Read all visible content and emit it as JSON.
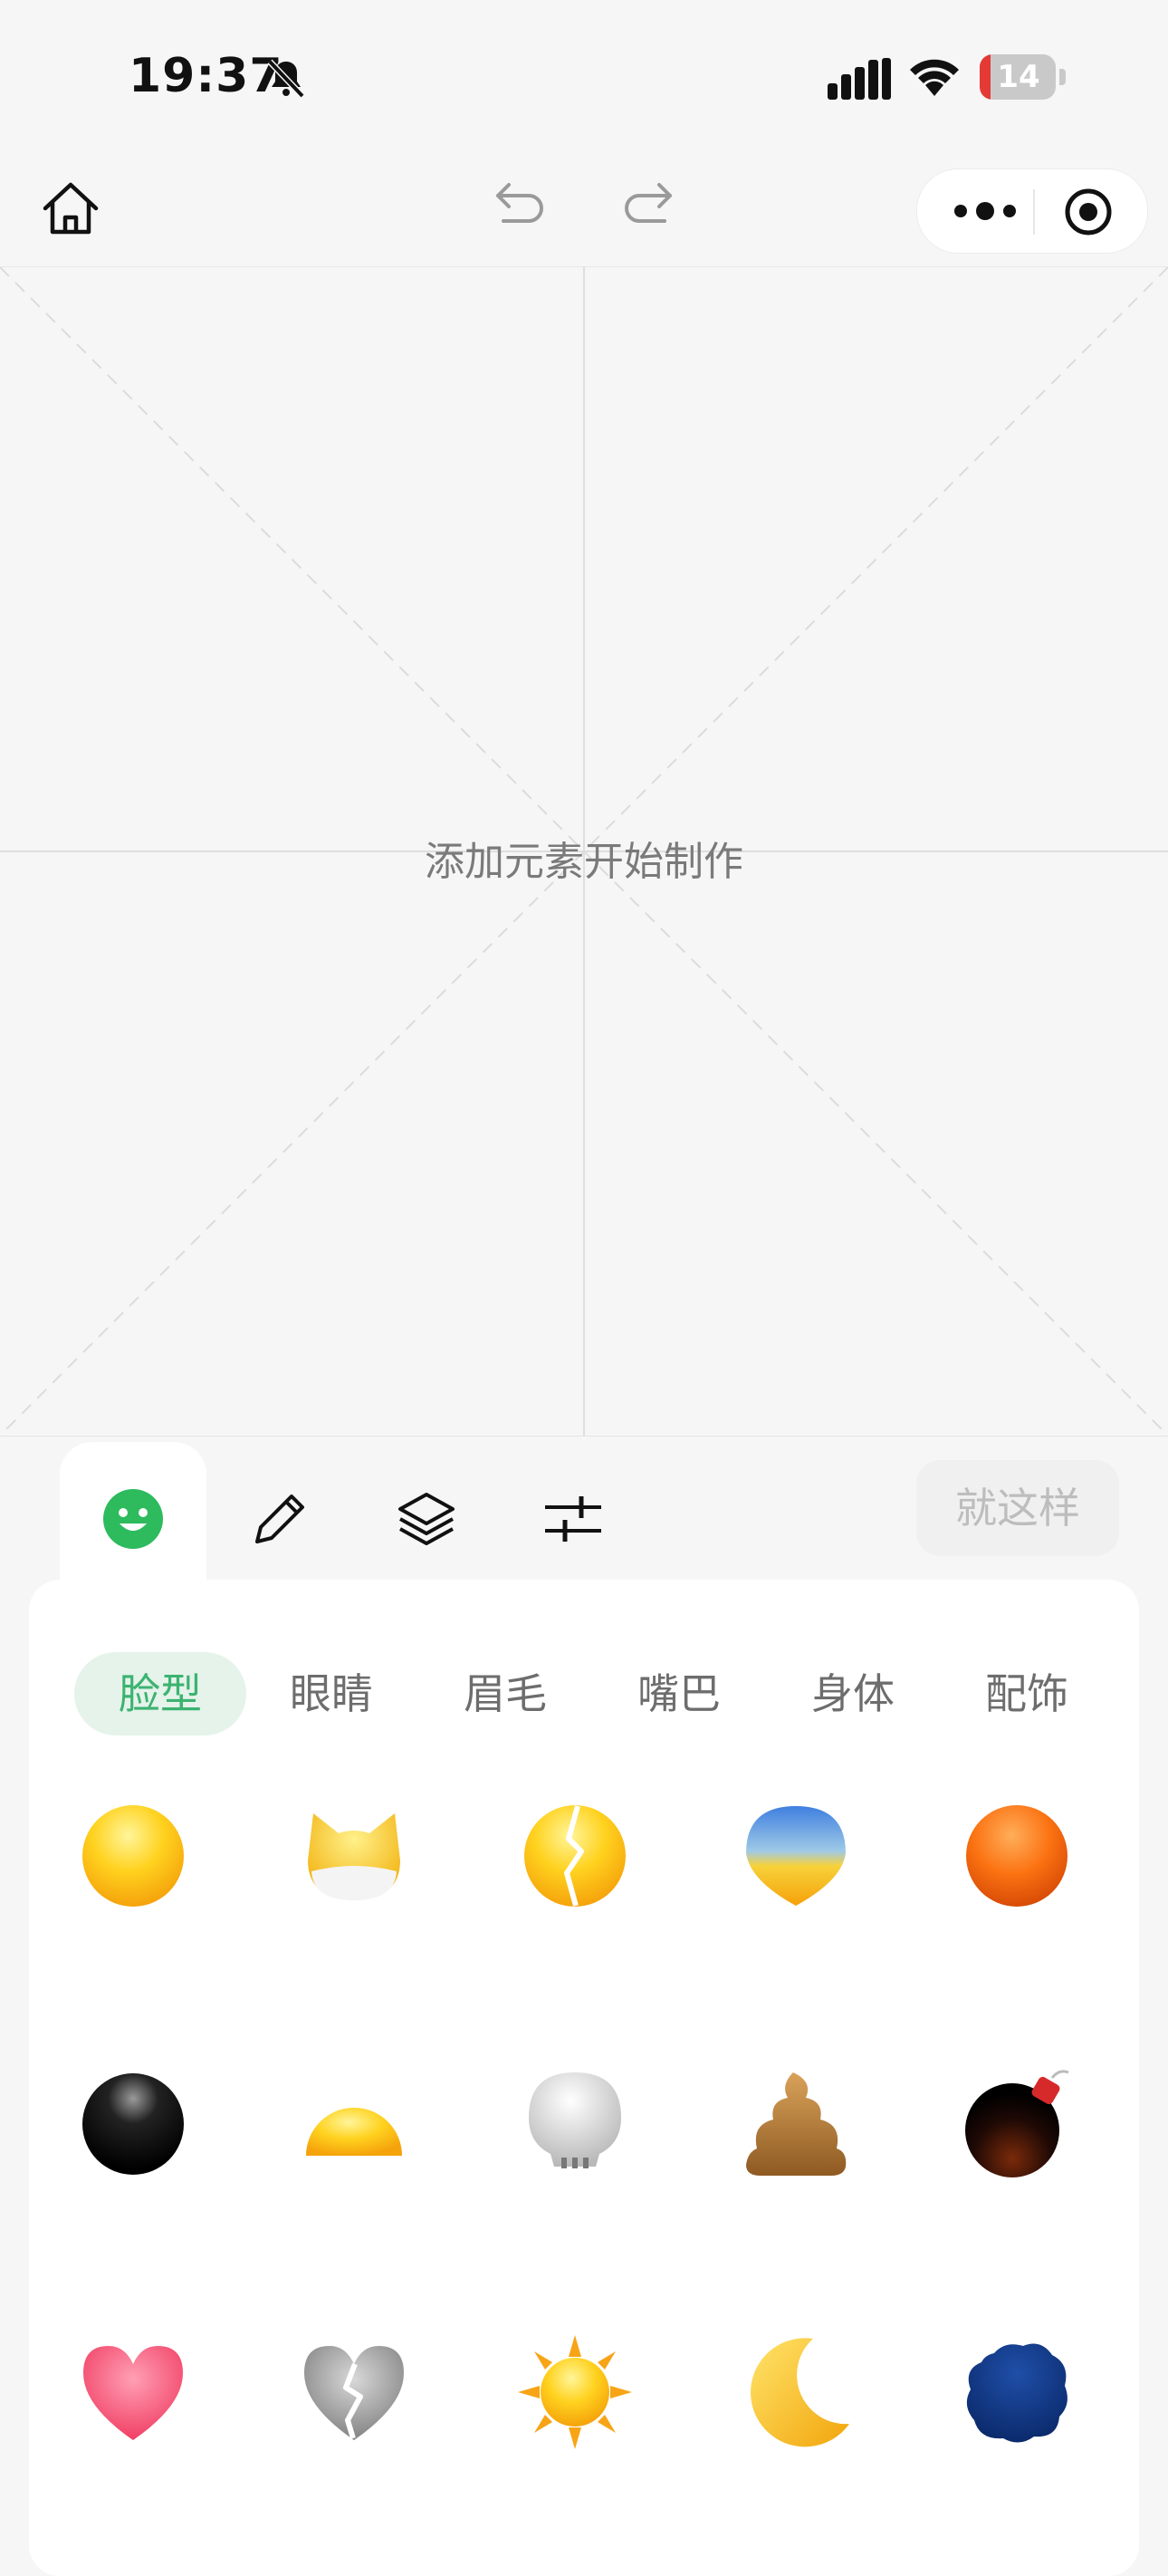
{
  "status_bar": {
    "time": "19:37",
    "battery": "14",
    "battery_level": 0.14,
    "battery_color": "#e53935"
  },
  "canvas": {
    "hint": "添加元素开始制作"
  },
  "toolbar": {
    "tools": [
      "emoji-icon",
      "pencil-icon",
      "layers-icon",
      "sliders-icon"
    ],
    "active_tool": "emoji-icon",
    "done_label": "就这样"
  },
  "categories": [
    {
      "label": "脸型",
      "active": true
    },
    {
      "label": "眼睛",
      "active": false
    },
    {
      "label": "眉毛",
      "active": false
    },
    {
      "label": "嘴巴",
      "active": false
    },
    {
      "label": "身体",
      "active": false
    },
    {
      "label": "配饰",
      "active": false
    }
  ],
  "faces": [
    [
      "yellow-face-icon",
      "cat-face-icon",
      "cracked-face-icon",
      "gradient-drop-face-icon",
      "orange-face-icon"
    ],
    [
      "black-face-icon",
      "half-face-icon",
      "skull-face-icon",
      "poop-face-icon",
      "bomb-face-icon"
    ],
    [
      "heart-face-icon",
      "broken-heart-face-icon",
      "sun-face-icon",
      "moon-face-icon",
      "cloud-face-icon"
    ]
  ],
  "accent_color": "#3cb371"
}
